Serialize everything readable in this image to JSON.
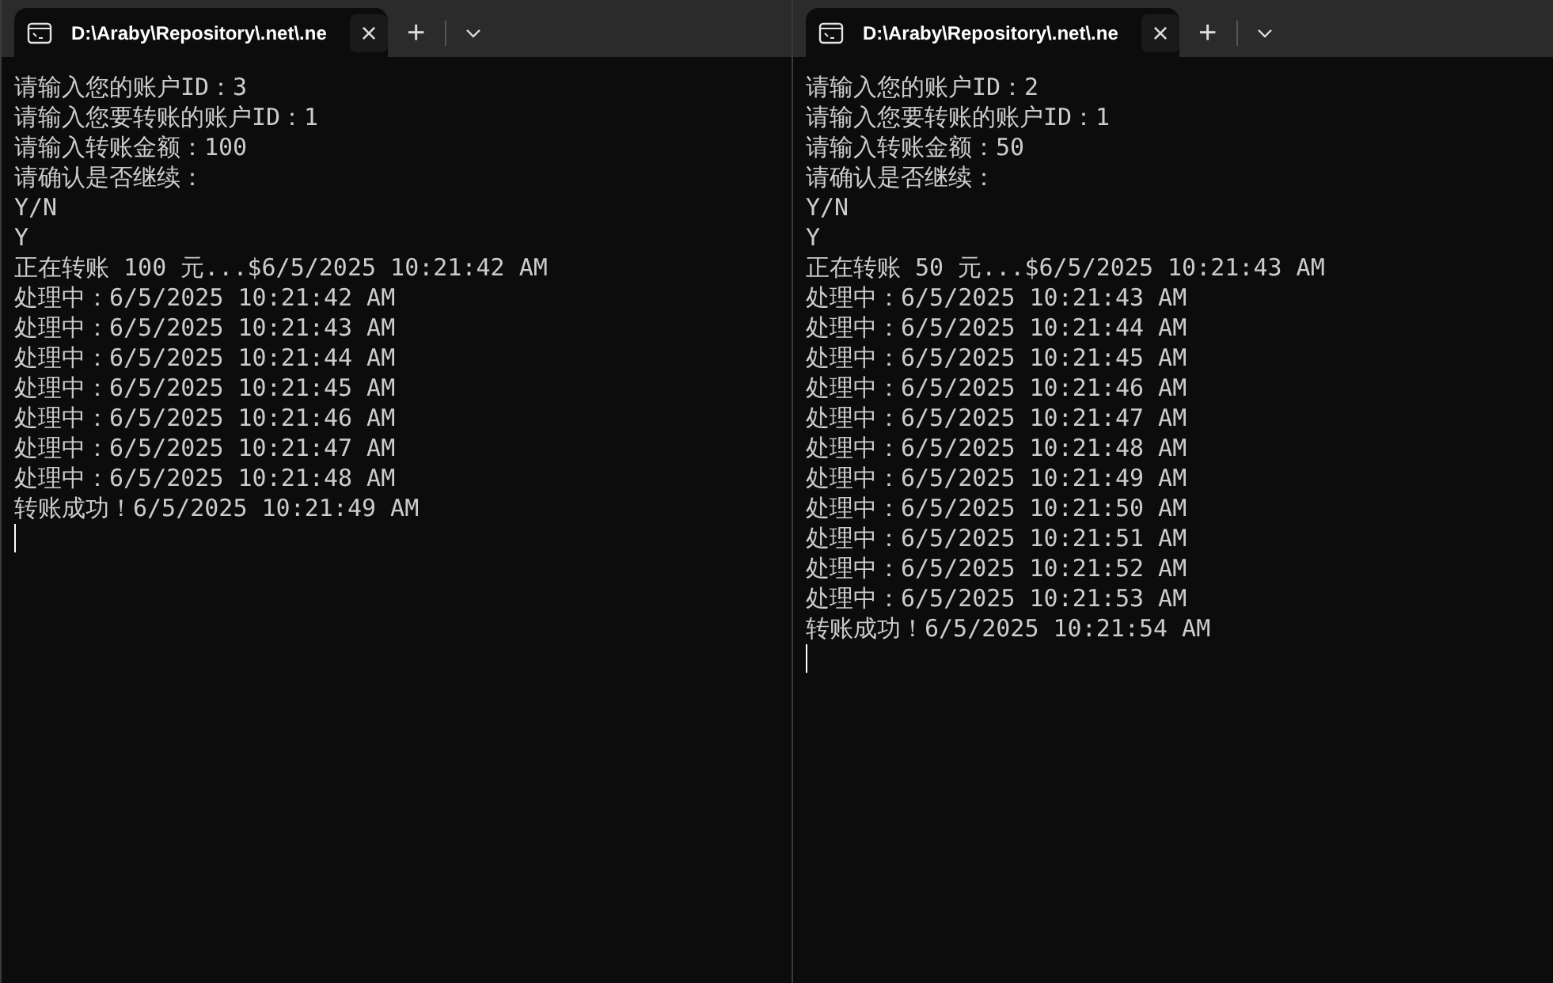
{
  "windows": [
    {
      "tab": {
        "title": "D:\\Araby\\Repository\\.net\\.ne",
        "selected": true
      },
      "close": "×",
      "new_tab": "+",
      "lines": [
        "请输入您的账户ID：3",
        "请输入您要转账的账户ID：1",
        "请输入转账金额：100",
        "请确认是否继续：",
        "Y/N",
        "Y",
        "正在转账 100 元...$6/5/2025 10:21:42 AM",
        "处理中：6/5/2025 10:21:42 AM",
        "处理中：6/5/2025 10:21:43 AM",
        "处理中：6/5/2025 10:21:44 AM",
        "处理中：6/5/2025 10:21:45 AM",
        "处理中：6/5/2025 10:21:46 AM",
        "处理中：6/5/2025 10:21:47 AM",
        "处理中：6/5/2025 10:21:48 AM",
        "转账成功！6/5/2025 10:21:49 AM"
      ]
    },
    {
      "tab": {
        "title": "D:\\Araby\\Repository\\.net\\.ne",
        "selected": true
      },
      "close": "×",
      "new_tab": "+",
      "lines": [
        "请输入您的账户ID：2",
        "请输入您要转账的账户ID：1",
        "请输入转账金额：50",
        "请确认是否继续：",
        "Y/N",
        "Y",
        "正在转账 50 元...$6/5/2025 10:21:43 AM",
        "处理中：6/5/2025 10:21:43 AM",
        "处理中：6/5/2025 10:21:44 AM",
        "处理中：6/5/2025 10:21:45 AM",
        "处理中：6/5/2025 10:21:46 AM",
        "处理中：6/5/2025 10:21:47 AM",
        "处理中：6/5/2025 10:21:48 AM",
        "处理中：6/5/2025 10:21:49 AM",
        "处理中：6/5/2025 10:21:50 AM",
        "处理中：6/5/2025 10:21:51 AM",
        "处理中：6/5/2025 10:21:52 AM",
        "处理中：6/5/2025 10:21:53 AM",
        "转账成功！6/5/2025 10:21:54 AM"
      ]
    }
  ]
}
